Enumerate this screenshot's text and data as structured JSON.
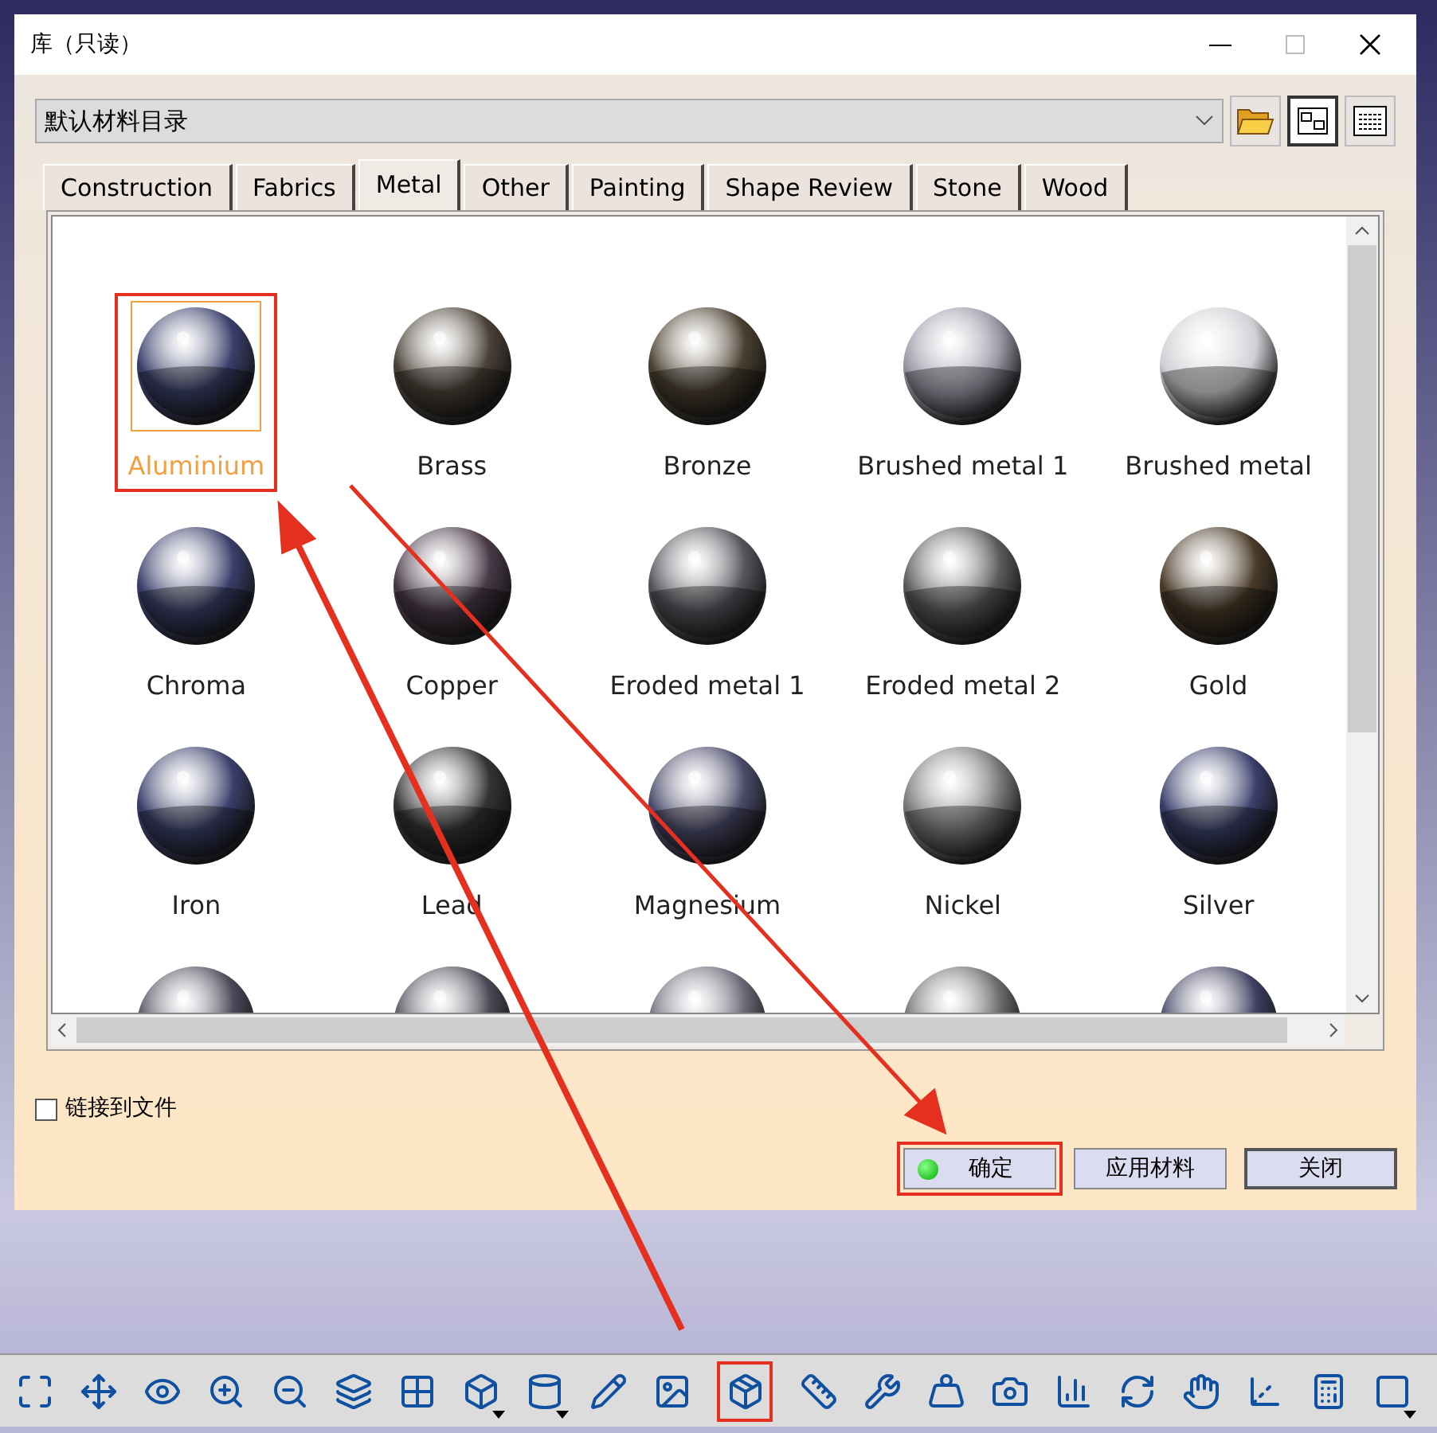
{
  "window": {
    "title": "库（只读）"
  },
  "catalog": {
    "value": "默认材料目录"
  },
  "tabs": [
    {
      "label": "Construction",
      "selected": false
    },
    {
      "label": "Fabrics",
      "selected": false
    },
    {
      "label": "Metal",
      "selected": true
    },
    {
      "label": "Other",
      "selected": false
    },
    {
      "label": "Painting",
      "selected": false
    },
    {
      "label": "Shape Review",
      "selected": false
    },
    {
      "label": "Stone",
      "selected": false
    },
    {
      "label": "Wood",
      "selected": false
    }
  ],
  "materials": [
    {
      "name": "Aluminium",
      "selected": true,
      "highlighted": true,
      "color": "#3a3f6a"
    },
    {
      "name": "Brass",
      "selected": false,
      "highlighted": false,
      "color": "#4a4238"
    },
    {
      "name": "Bronze",
      "selected": false,
      "highlighted": false,
      "color": "#4a4030"
    },
    {
      "name": "Brushed metal 1",
      "selected": false,
      "highlighted": false,
      "color": "#9a9aa8"
    },
    {
      "name": "Brushed metal",
      "selected": false,
      "highlighted": false,
      "color": "#cfcfd4"
    },
    {
      "name": "Chroma",
      "selected": false,
      "highlighted": false,
      "color": "#3a3f6a"
    },
    {
      "name": "Copper",
      "selected": false,
      "highlighted": false,
      "color": "#4a3a48"
    },
    {
      "name": "Eroded metal 1",
      "selected": false,
      "highlighted": false,
      "color": "#55565c"
    },
    {
      "name": "Eroded metal 2",
      "selected": false,
      "highlighted": false,
      "color": "#5a5c5e"
    },
    {
      "name": "Gold",
      "selected": false,
      "highlighted": false,
      "color": "#4a3a28"
    },
    {
      "name": "Iron",
      "selected": false,
      "highlighted": false,
      "color": "#3a3f6a"
    },
    {
      "name": "Lead",
      "selected": false,
      "highlighted": false,
      "color": "#333333"
    },
    {
      "name": "Magnesium",
      "selected": false,
      "highlighted": false,
      "color": "#4a4a6a"
    },
    {
      "name": "Nickel",
      "selected": false,
      "highlighted": false,
      "color": "#7a7a7c"
    },
    {
      "name": "Silver",
      "selected": false,
      "highlighted": false,
      "color": "#3a3f6a"
    },
    {
      "selected": false,
      "highlighted": false,
      "color": "#4a4a5a"
    },
    {
      "selected": false,
      "highlighted": false,
      "color": "#4a4a56"
    },
    {
      "selected": false,
      "highlighted": false,
      "color": "#6a6a78"
    },
    {
      "selected": false,
      "highlighted": false,
      "color": "#6c6c6e"
    },
    {
      "selected": false,
      "highlighted": false,
      "color": "#3f3f60"
    }
  ],
  "link_to_file": {
    "label": "链接到文件",
    "checked": false
  },
  "buttons": [
    {
      "label": "确定",
      "kind": "ok",
      "highlighted": true
    },
    {
      "label": "应用材料",
      "kind": "plain",
      "highlighted": false
    },
    {
      "label": "关闭",
      "kind": "focused",
      "highlighted": false
    }
  ],
  "toolbar": [
    {
      "highlighted": false,
      "dropdown": false
    },
    {
      "highlighted": false,
      "dropdown": false
    },
    {
      "highlighted": false,
      "dropdown": false
    },
    {
      "highlighted": false,
      "dropdown": false
    },
    {
      "highlighted": false,
      "dropdown": false
    },
    {
      "highlighted": false,
      "dropdown": false
    },
    {
      "highlighted": false,
      "dropdown": false
    },
    {
      "highlighted": false,
      "dropdown": true
    },
    {
      "highlighted": false,
      "dropdown": true
    },
    {
      "highlighted": false,
      "dropdown": false
    },
    {
      "highlighted": false,
      "dropdown": false
    },
    {
      "highlighted": true,
      "dropdown": false
    },
    {
      "highlighted": false,
      "dropdown": false
    },
    {
      "highlighted": false,
      "dropdown": false
    },
    {
      "highlighted": false,
      "dropdown": false
    },
    {
      "highlighted": false,
      "dropdown": false
    },
    {
      "highlighted": false,
      "dropdown": false
    },
    {
      "highlighted": false,
      "dropdown": false
    },
    {
      "highlighted": false,
      "dropdown": false
    },
    {
      "highlighted": false,
      "dropdown": false
    },
    {
      "highlighted": false,
      "dropdown": false
    },
    {
      "highlighted": false,
      "dropdown": true
    }
  ]
}
